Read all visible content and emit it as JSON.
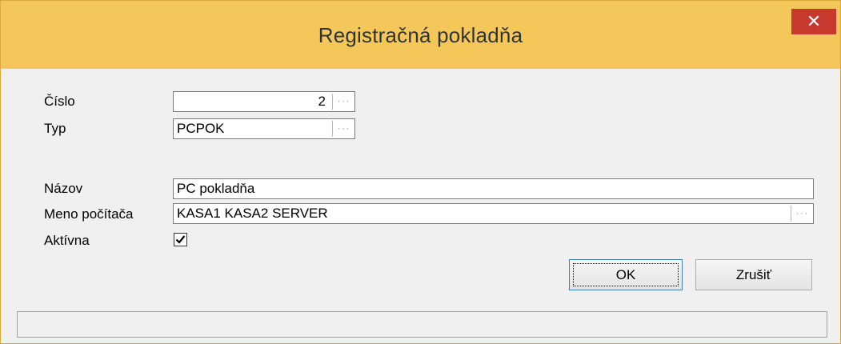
{
  "window": {
    "title": "Registračná pokladňa",
    "close_icon": "close-icon",
    "colors": {
      "titlebar": "#f3c75a",
      "close_button": "#c7392f",
      "default_button_border": "#3c7fb1"
    }
  },
  "form": {
    "cislo": {
      "label": "Číslo",
      "value": "2",
      "browse_icon": "ellipsis-icon"
    },
    "typ": {
      "label": "Typ",
      "value": "PCPOK",
      "browse_icon": "ellipsis-icon"
    },
    "nazov": {
      "label": "Názov",
      "value": "PC pokladňa"
    },
    "meno_pocitaca": {
      "label": "Meno počítača",
      "value": "KASA1 KASA2 SERVER",
      "browse_icon": "ellipsis-icon"
    },
    "aktivna": {
      "label": "Aktívna",
      "checked": true,
      "icon": "checkmark-icon"
    }
  },
  "buttons": {
    "ok": "OK",
    "cancel": "Zrušiť"
  },
  "statusbar": {
    "text": ""
  }
}
